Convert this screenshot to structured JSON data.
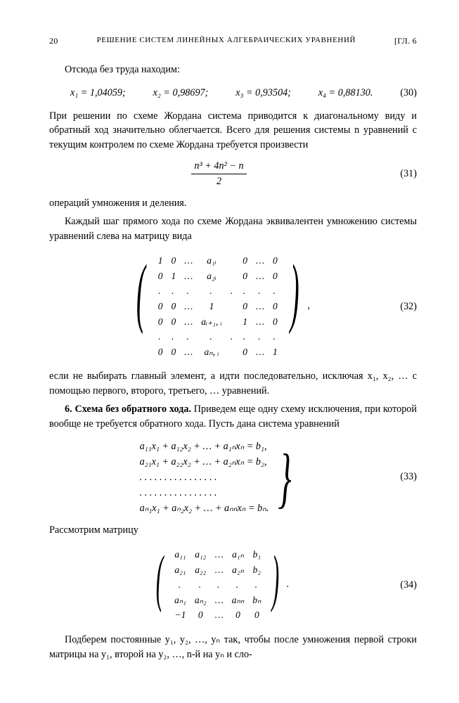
{
  "header": {
    "page_number": "20",
    "running_title": "РЕШЕНИЕ СИСТЕМ ЛИНЕЙНЫХ АЛГЕБРАИЧЕСКИХ УРАВНЕНИЙ",
    "chapter_mark": "[ГЛ. 6"
  },
  "p_intro": "Отсюда без труда находим:",
  "solutions": {
    "x1": "x₁ = 1,04059;",
    "x2": "x₂ = 0,98697;",
    "x3": "x₃ = 0,93504;",
    "x4": "x₄ = 0,88130.",
    "eqnum": "(30)"
  },
  "p_after_sol": "При решении по схеме Жордана система приводится к диагональному виду и обратный ход значительно облегчается. Всего для решения системы n уравнений с текущим контролем по схеме Жордана требуется произвести",
  "eq31": {
    "num": "n³ + 4n² − n",
    "den": "2",
    "eqnum": "(31)"
  },
  "p_ops": "операций умножения и деления.",
  "p_step": "Каждый шаг прямого хода по схеме Жордана эквивалентен умножению системы уравнений слева на матрицу вида",
  "matrix32": {
    "rows": [
      [
        "1",
        "0",
        "…",
        "a₁ᵢ",
        "",
        "0",
        "…",
        "0"
      ],
      [
        "0",
        "1",
        "…",
        "a₂ᵢ",
        "",
        "0",
        "…",
        "0"
      ],
      [
        ".",
        ".",
        ".",
        ".",
        ".",
        ".",
        ".",
        "."
      ],
      [
        "0",
        "0",
        "…",
        "1",
        "",
        "0",
        "…",
        "0"
      ],
      [
        "0",
        "0",
        "…",
        "aᵢ₊₁, ᵢ",
        "",
        "1",
        "…",
        "0"
      ],
      [
        ".",
        ".",
        ".",
        ".",
        ".",
        ".",
        ".",
        "."
      ],
      [
        "0",
        "0",
        "…",
        "aₙ, ᵢ",
        "",
        "0",
        "…",
        "1"
      ]
    ],
    "tail": ",",
    "eqnum": "(32)"
  },
  "p_after32": "если не выбирать главный элемент, а идти последовательно, исключая x₁, x₂, … с помощью первого, второго, третьего, … уравнений.",
  "section6": {
    "title": "6. Схема без обратного хода.",
    "text": " Приведем еще одну схему исключения, при которой вообще не требуется обратного хода. Пусть дана система уравнений"
  },
  "eq33": {
    "lines": [
      "a₁₁x₁ + a₁₂x₂ + … + a₁ₙxₙ = b₁,",
      "a₂₁x₁ + a₂₂x₂ + … + a₂ₙxₙ = b₂,",
      ". . . . . . . . . . . . . . . .",
      ". . . . . . . . . . . . . . . .",
      "aₙ₁x₁ + aₙ₂x₂ + … + aₙₙxₙ = bₙ."
    ],
    "eqnum": "(33)"
  },
  "p_consider": "Рассмотрим матрицу",
  "matrix34": {
    "rows": [
      [
        "a₁₁",
        "a₁₂",
        "…",
        "a₁ₙ",
        "b₁"
      ],
      [
        "a₂₁",
        "a₂₂",
        "…",
        "a₂ₙ",
        "b₂"
      ],
      [
        ".",
        ".",
        ".",
        ".",
        "."
      ],
      [
        "aₙ₁",
        "aₙ₂",
        "…",
        "aₙₙ",
        "bₙ"
      ],
      [
        "−1",
        "0",
        "…",
        "0",
        "0"
      ]
    ],
    "tail": ".",
    "eqnum": "(34)"
  },
  "p_last": "Подберем постоянные y₁, y₂, …, yₙ так, чтобы после умножения первой строки матрицы на y₁, второй на y₂, …, n-й на yₙ и сло-"
}
